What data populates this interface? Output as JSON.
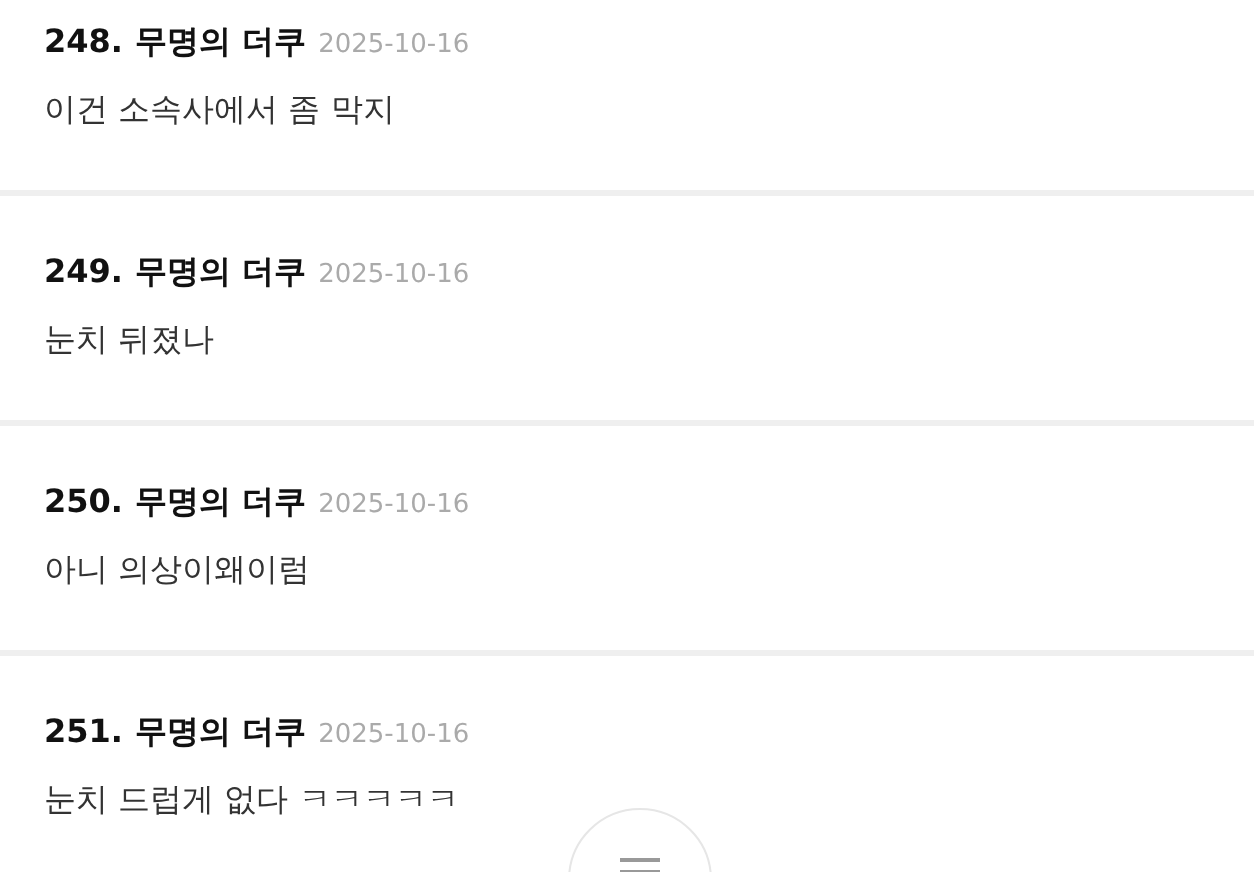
{
  "comments": [
    {
      "number": "248.",
      "author": "무명의 더쿠",
      "date": "2025-10-16",
      "text": "이건 소속사에서 좀 막지"
    },
    {
      "number": "249.",
      "author": "무명의 더쿠",
      "date": "2025-10-16",
      "text": "눈치 뒤졌나"
    },
    {
      "number": "250.",
      "author": "무명의 더쿠",
      "date": "2025-10-16",
      "text": "아니 의상이왜이럼"
    },
    {
      "number": "251.",
      "author": "무명의 더쿠",
      "date": "2025-10-16",
      "text": "눈치 드럽게 없다 ㅋㅋㅋㅋㅋ"
    }
  ]
}
